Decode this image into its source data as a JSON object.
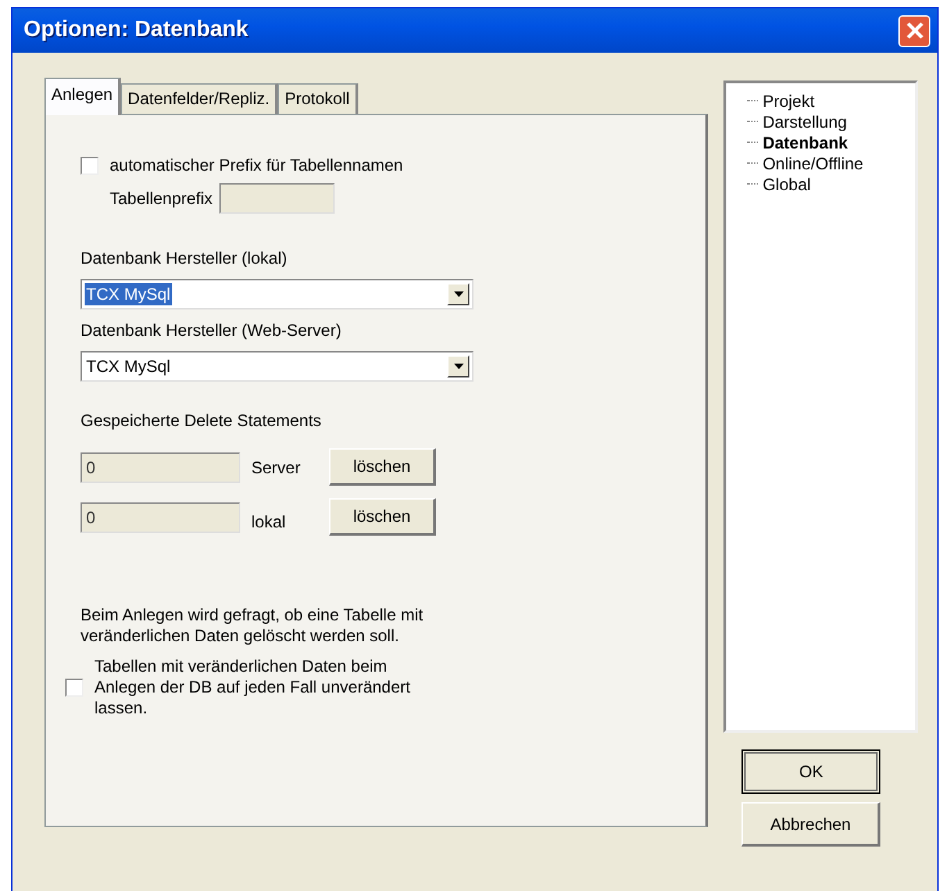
{
  "window": {
    "title": "Optionen: Datenbank"
  },
  "tabs": [
    {
      "label": "Anlegen",
      "selected": true
    },
    {
      "label": "Datenfelder/Repliz.",
      "selected": false
    },
    {
      "label": "Protokoll",
      "selected": false
    }
  ],
  "prefix_option": {
    "label": "automatischer Prefix für Tabellennamen",
    "checked": false
  },
  "prefix_field": {
    "label": "Tabellenprefix",
    "disabled": true
  },
  "vendor_local": {
    "label": "Datenbank Hersteller (lokal)",
    "value": "TCX MySql",
    "text_highlighted": true
  },
  "vendor_web": {
    "label": "Datenbank Hersteller (Web-Server)",
    "value": "TCX MySql",
    "text_highlighted": false
  },
  "deletes": {
    "label": "Gespeicherte Delete Statements",
    "rows": [
      {
        "value": "0",
        "label": "Server",
        "button": "löschen"
      },
      {
        "value": "0",
        "label": "lokal",
        "button": "löschen"
      }
    ]
  },
  "info": "Beim Anlegen wird gefragt, ob eine Tabelle mit veränderlichen Daten gelöscht werden soll.",
  "keep_option": {
    "label": "Tabellen mit veränderlichen Daten beim Anlegen der DB auf jeden Fall unverändert lassen.",
    "checked": false
  },
  "tree": [
    {
      "label": "Projekt",
      "selected": false
    },
    {
      "label": "Darstellung",
      "selected": false
    },
    {
      "label": "Datenbank",
      "selected": true
    },
    {
      "label": "Online/Offline",
      "selected": false
    },
    {
      "label": "Global",
      "selected": false
    }
  ],
  "buttons": [
    {
      "label": "OK",
      "default": true
    },
    {
      "label": "Abbrechen",
      "default": false
    }
  ]
}
